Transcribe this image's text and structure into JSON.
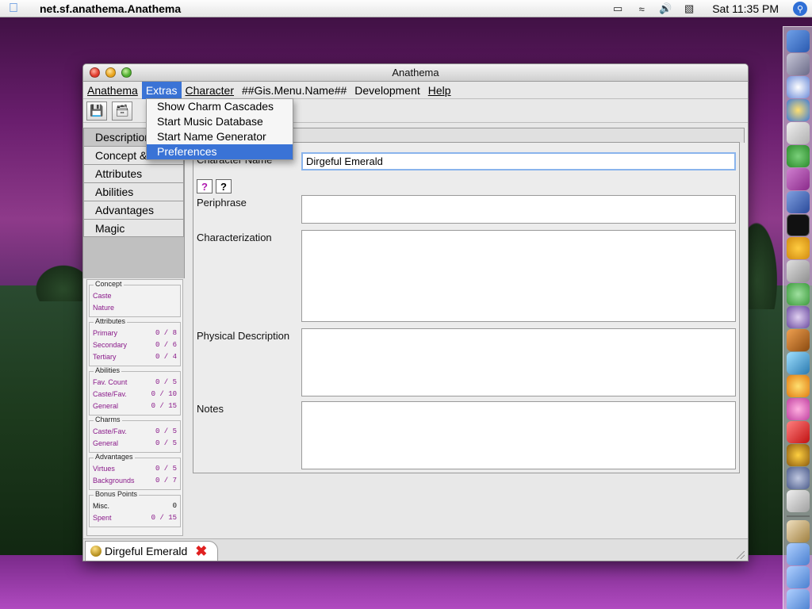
{
  "system_menubar": {
    "app_name": "net.sf.anathema.Anathema",
    "clock": "Sat 11:35 PM"
  },
  "window": {
    "title": "Anathema"
  },
  "app_menu": [
    {
      "label": "Anathema"
    },
    {
      "label": "Extras"
    },
    {
      "label": "Character"
    },
    {
      "label": "##Gis.Menu.Name##"
    },
    {
      "label": "Development"
    },
    {
      "label": "Help"
    }
  ],
  "extras_menu": [
    {
      "label": "Show Charm Cascades"
    },
    {
      "label": "Start Music Database"
    },
    {
      "label": "Start Name Generator"
    },
    {
      "label": "Preferences"
    }
  ],
  "nav": [
    {
      "label": "Description"
    },
    {
      "label": "Concept & Rules"
    },
    {
      "label": "Attributes"
    },
    {
      "label": "Abilities"
    },
    {
      "label": "Advantages"
    },
    {
      "label": "Magic"
    }
  ],
  "summary": {
    "concept": {
      "title": "Concept",
      "rows": [
        {
          "label": "Caste",
          "value": ""
        },
        {
          "label": "Nature",
          "value": ""
        }
      ]
    },
    "attributes": {
      "title": "Attributes",
      "rows": [
        {
          "label": "Primary",
          "value": "0 /  8"
        },
        {
          "label": "Secondary",
          "value": "0 /  6"
        },
        {
          "label": "Tertiary",
          "value": "0 /  4"
        }
      ]
    },
    "abilities": {
      "title": "Abilities",
      "rows": [
        {
          "label": "Fav. Count",
          "value": "0 /  5"
        },
        {
          "label": "Caste/Fav.",
          "value": "0 / 10"
        },
        {
          "label": "General",
          "value": "0 / 15"
        }
      ]
    },
    "charms": {
      "title": "Charms",
      "rows": [
        {
          "label": "Caste/Fav.",
          "value": "0 /  5"
        },
        {
          "label": "General",
          "value": "0 /  5"
        }
      ]
    },
    "advantages": {
      "title": "Advantages",
      "rows": [
        {
          "label": "Virtues",
          "value": "0 /  5"
        },
        {
          "label": "Backgrounds",
          "value": "0 /  7"
        }
      ]
    },
    "bonus": {
      "title": "Bonus Points",
      "rows": [
        {
          "label": "Misc.",
          "value": "0"
        },
        {
          "label": "Spent",
          "value": "0 / 15"
        }
      ]
    }
  },
  "form": {
    "character_name_label": "Character Name",
    "character_name_value": "Dirgeful Emerald",
    "periphrase_label": "Periphrase",
    "characterization_label": "Characterization",
    "physical_description_label": "Physical Description",
    "notes_label": "Notes"
  },
  "doc_tab": {
    "label": "Dirgeful Emerald"
  },
  "colors": {
    "menu_highlight": "#3a73d6",
    "summary_text": "#8a1a8a"
  }
}
